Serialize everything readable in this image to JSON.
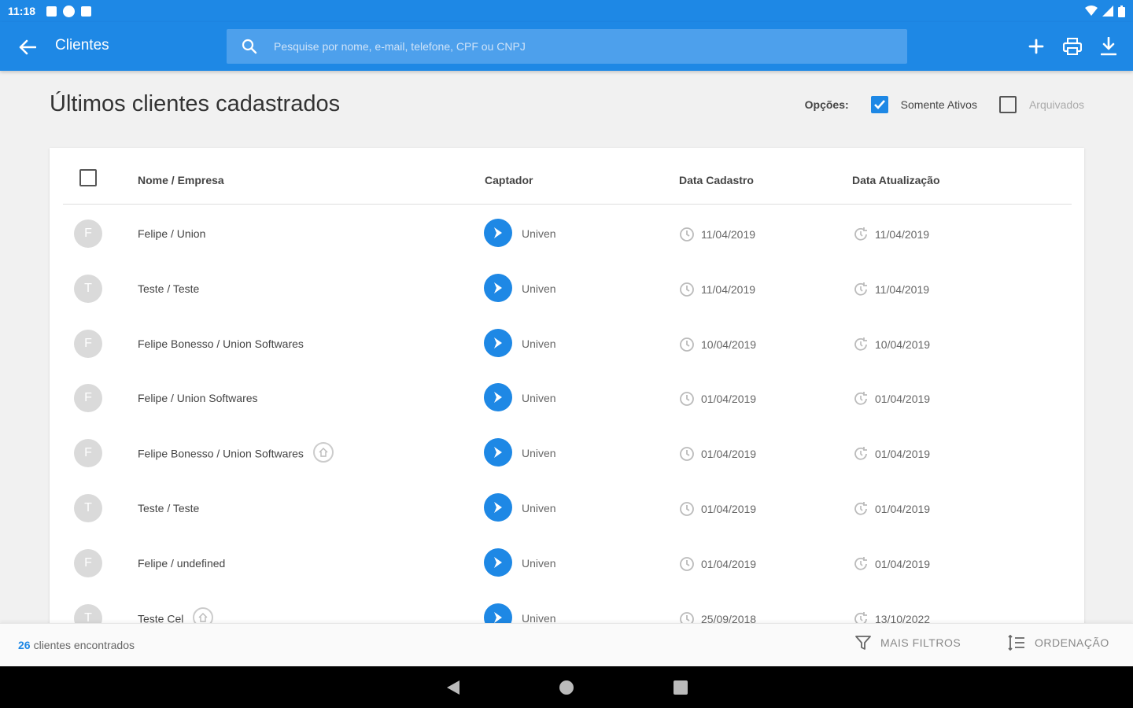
{
  "status_bar": {
    "time": "11:18"
  },
  "app_bar": {
    "title": "Clientes",
    "search_placeholder": "Pesquise por nome, e-mail, telefone, CPF ou CNPJ"
  },
  "page": {
    "title": "Últimos clientes cadastrados",
    "options_label": "Opções:",
    "option_active": {
      "label": "Somente Ativos",
      "checked": true
    },
    "option_archived": {
      "label": "Arquivados",
      "checked": false
    }
  },
  "table": {
    "headers": {
      "name": "Nome / Empresa",
      "captador": "Captador",
      "created": "Data Cadastro",
      "updated": "Data Atualização"
    },
    "rows": [
      {
        "initial": "F",
        "name": "Felipe / Union",
        "home_icon": false,
        "captador": "Univen",
        "created": "11/04/2019",
        "updated": "11/04/2019"
      },
      {
        "initial": "T",
        "name": "Teste / Teste",
        "home_icon": false,
        "captador": "Univen",
        "created": "11/04/2019",
        "updated": "11/04/2019"
      },
      {
        "initial": "F",
        "name": "Felipe Bonesso / Union Softwares",
        "home_icon": false,
        "captador": "Univen",
        "created": "10/04/2019",
        "updated": "10/04/2019"
      },
      {
        "initial": "F",
        "name": "Felipe / Union Softwares",
        "home_icon": false,
        "captador": "Univen",
        "created": "01/04/2019",
        "updated": "01/04/2019"
      },
      {
        "initial": "F",
        "name": "Felipe Bonesso / Union Softwares",
        "home_icon": true,
        "captador": "Univen",
        "created": "01/04/2019",
        "updated": "01/04/2019"
      },
      {
        "initial": "T",
        "name": "Teste / Teste",
        "home_icon": false,
        "captador": "Univen",
        "created": "01/04/2019",
        "updated": "01/04/2019"
      },
      {
        "initial": "F",
        "name": "Felipe / undefined",
        "home_icon": false,
        "captador": "Univen",
        "created": "01/04/2019",
        "updated": "01/04/2019"
      },
      {
        "initial": "T",
        "name": "Teste Cel",
        "home_icon": true,
        "captador": "Univen",
        "created": "25/09/2018",
        "updated": "13/10/2022"
      }
    ]
  },
  "footer": {
    "count": "26",
    "count_label": "clientes encontrados",
    "filters_label": "MAIS FILTROS",
    "sort_label": "ORDENAÇÃO"
  },
  "colors": {
    "primary": "#1e88e5",
    "background": "#f1f1f1"
  }
}
